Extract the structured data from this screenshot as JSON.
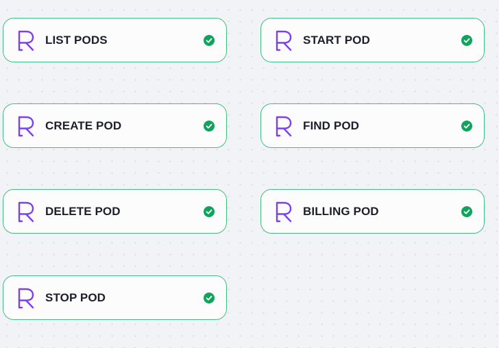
{
  "colors": {
    "background": "#f2f3f7",
    "node_border": "#3fbf7f",
    "logo_purple": "#7b3ff2",
    "check_green": "#10a35c",
    "label_text": "#1c1f2b"
  },
  "icons": {
    "logo": "runpod-r-logo-icon",
    "status": "check-circle-icon"
  },
  "nodes": [
    {
      "label": "LIST PODS",
      "status": "success"
    },
    {
      "label": "START POD",
      "status": "success"
    },
    {
      "label": "CREATE POD",
      "status": "success"
    },
    {
      "label": "FIND POD",
      "status": "success"
    },
    {
      "label": "DELETE POD",
      "status": "success"
    },
    {
      "label": "BILLING POD",
      "status": "success"
    },
    {
      "label": "STOP POD",
      "status": "success"
    }
  ]
}
